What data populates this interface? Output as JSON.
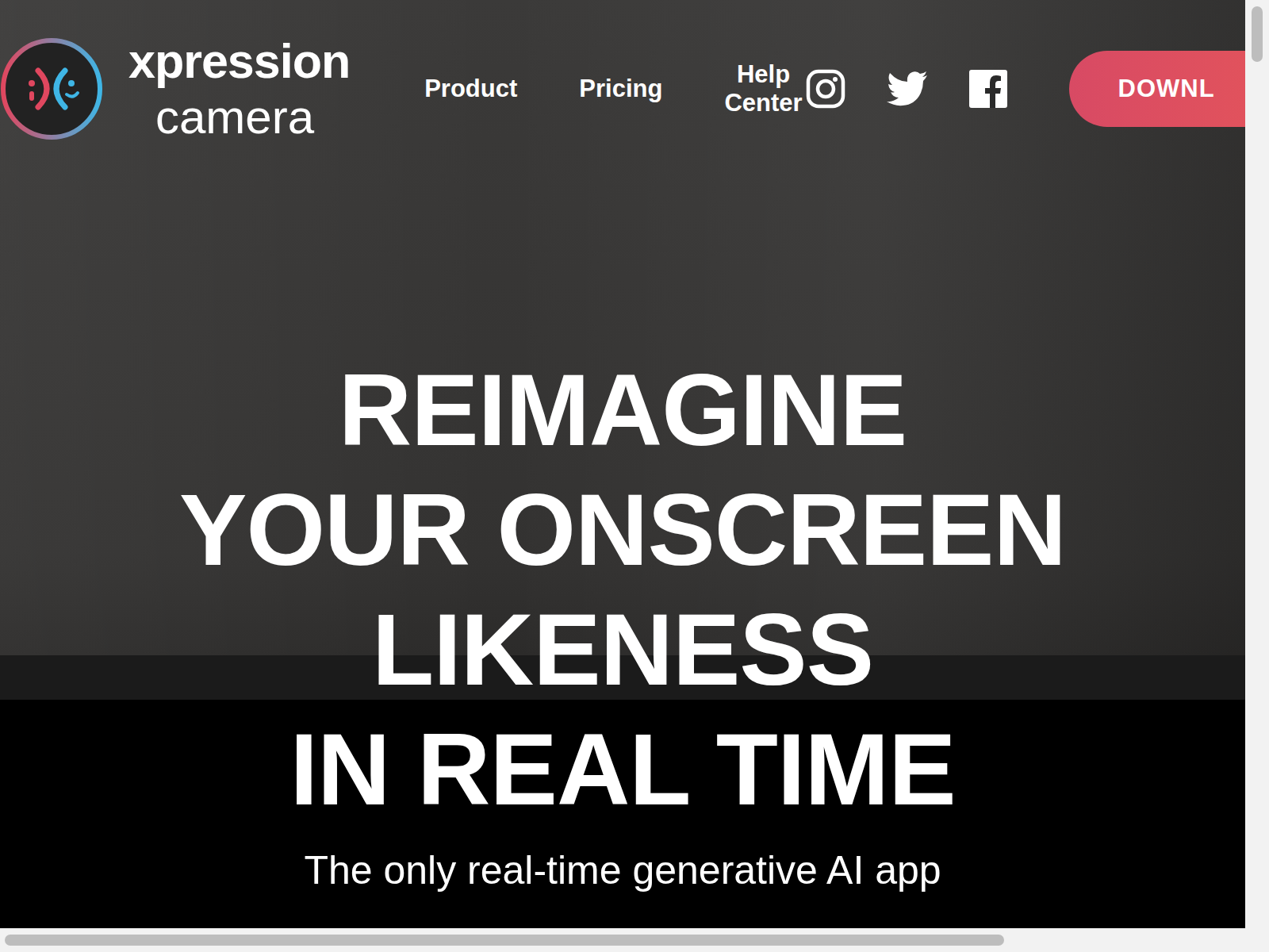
{
  "logo": {
    "line1": "xpression",
    "line2": "camera"
  },
  "nav": [
    {
      "label": "Product"
    },
    {
      "label": "Pricing"
    },
    {
      "label": "Help Center"
    }
  ],
  "download": {
    "label": "DOWNL"
  },
  "hero": {
    "lines": [
      "REIMAGINE",
      "YOUR ONSCREEN",
      "LIKENESS",
      "IN REAL TIME"
    ],
    "subtitle": "The only real-time generative AI app"
  }
}
